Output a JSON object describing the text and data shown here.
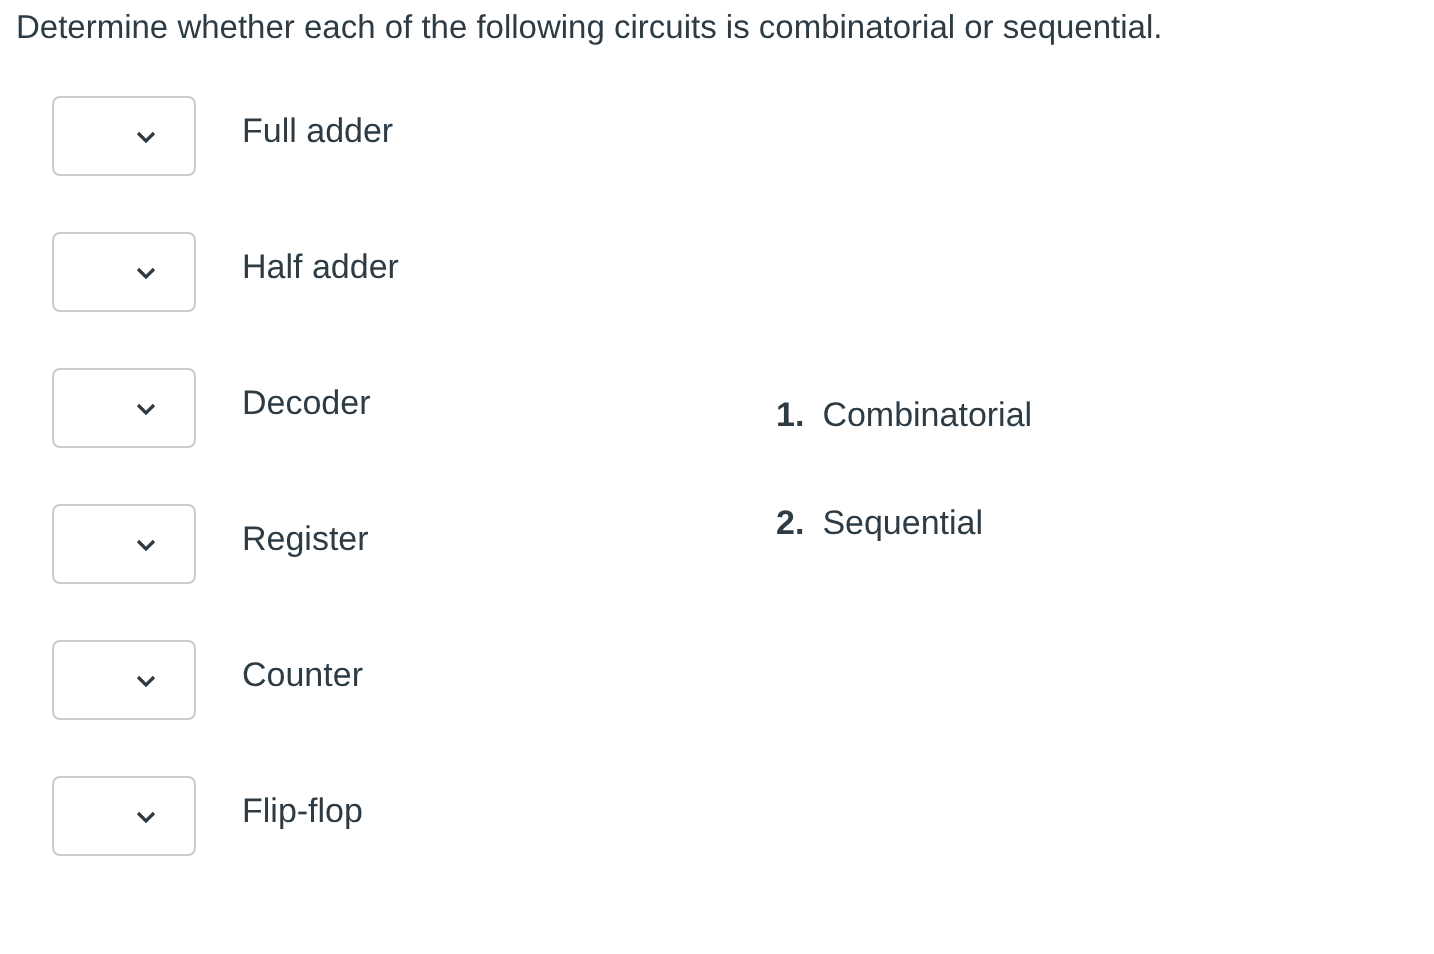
{
  "question": {
    "prompt": "Determine whether each of the following circuits is combinatorial or sequential."
  },
  "items": [
    {
      "label": "Full adder"
    },
    {
      "label": "Half adder"
    },
    {
      "label": "Decoder"
    },
    {
      "label": "Register"
    },
    {
      "label": "Counter"
    },
    {
      "label": "Flip-flop"
    }
  ],
  "options": [
    {
      "number": "1.",
      "label": "Combinatorial"
    },
    {
      "number": "2.",
      "label": "Sequential"
    }
  ]
}
